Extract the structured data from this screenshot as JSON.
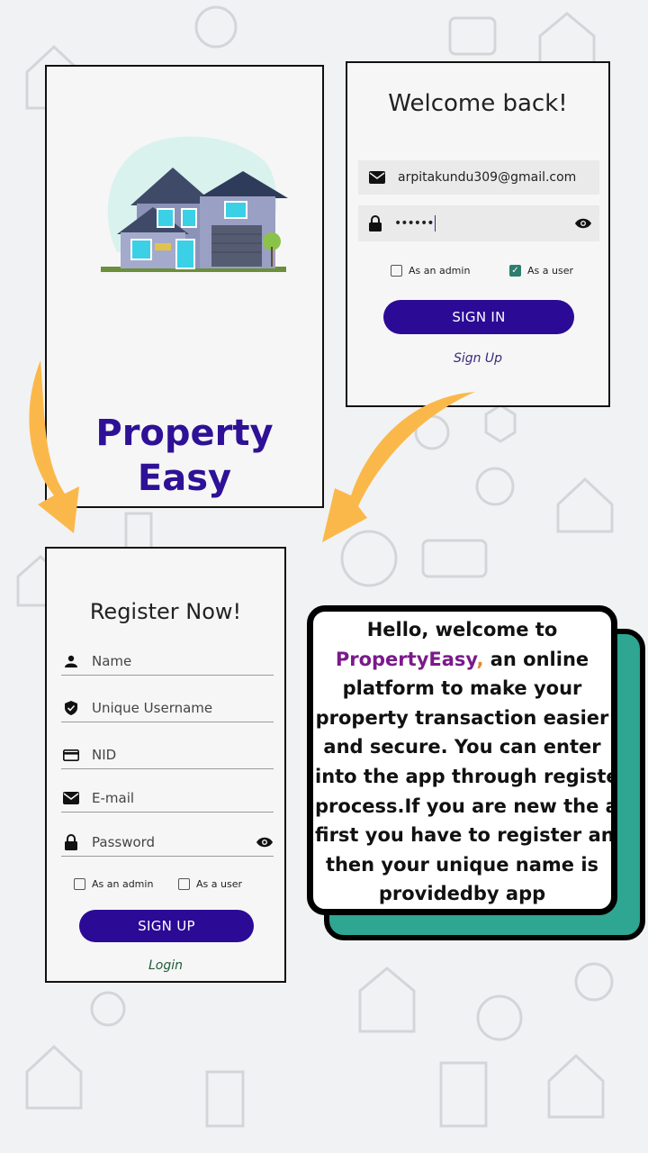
{
  "splash": {
    "title_line1": "Property",
    "title_line2": "Easy"
  },
  "login": {
    "heading": "Welcome back!",
    "email_value": "arpitakundu309@gmail.com",
    "password_value": "••••••",
    "admin_label": "As an admin",
    "admin_checked": false,
    "user_label": "As a user",
    "user_checked": true,
    "sign_in_label": "SIGN IN",
    "sign_up_link": "Sign Up"
  },
  "register": {
    "heading": "Register Now!",
    "fields": {
      "name": "Name",
      "username": "Unique Username",
      "nid": "NID",
      "email": "E-mail",
      "password": "Password"
    },
    "admin_label": "As an admin",
    "user_label": "As a user",
    "sign_up_label": "SIGN UP",
    "login_link": "Login"
  },
  "callout": {
    "line1": "Hello, welcome to",
    "brand": "PropertyEasy",
    "comma": ",",
    "line2_rest": " an online",
    "line3": "platform to make your",
    "line4": "property transaction easier",
    "line5": "and secure. You can enter",
    "line6": "into the app through register",
    "line7": "process.If you are new the at",
    "line8": "first you have to register and",
    "line9": "then your unique name is",
    "line10": "providedby app"
  },
  "colors": {
    "brand_purple": "#2b0a96",
    "accent_teal": "#2ea692",
    "arrow_orange": "#fbb84a"
  }
}
